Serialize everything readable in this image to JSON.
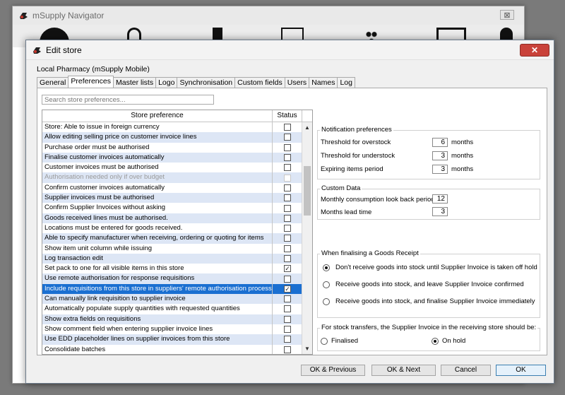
{
  "navigator": {
    "title": "mSupply Navigator",
    "close_label": "⊠"
  },
  "dialog": {
    "title": "Edit store",
    "close_label": "✕",
    "store_name": "Local Pharmacy (mSupply Mobile)",
    "tabs": [
      "General",
      "Preferences",
      "Master lists",
      "Logo",
      "Synchronisation",
      "Custom fields",
      "Users",
      "Names",
      "Log"
    ],
    "active_tab": "Preferences",
    "search_placeholder": "Search store preferences...",
    "table": {
      "col_preference": "Store preference",
      "col_status": "Status",
      "rows": [
        {
          "label": "Store: Able to issue in foreign currency",
          "checked": false
        },
        {
          "label": "Allow editing selling price on customer invoice lines",
          "checked": false
        },
        {
          "label": "Purchase order must be authorised",
          "checked": false
        },
        {
          "label": "Finalise customer invoices automatically",
          "checked": false
        },
        {
          "label": "Customer invoices must be authorised",
          "checked": false
        },
        {
          "label": "Authorisation needed only if over budget",
          "checked": false,
          "disabled": true
        },
        {
          "label": "Confirm customer invoices automatically",
          "checked": false
        },
        {
          "label": "Supplier invoices must be authorised",
          "checked": false
        },
        {
          "label": "Confirm Supplier Invoices without asking",
          "checked": false
        },
        {
          "label": "Goods received lines must be authorised.",
          "checked": false
        },
        {
          "label": "Locations must be entered for goods received.",
          "checked": false
        },
        {
          "label": "Able to specify manufacturer when receiving, ordering or quoting for items",
          "checked": false
        },
        {
          "label": "Show item unit column while issuing",
          "checked": false
        },
        {
          "label": "Log transaction edit",
          "checked": false
        },
        {
          "label": "Set pack to one for all visible items in this store",
          "checked": true
        },
        {
          "label": "Use remote authorisation for response requisitions",
          "checked": false
        },
        {
          "label": "Include requisitions from this store in suppliers' remote authorisation processes",
          "checked": true,
          "selected": true
        },
        {
          "label": "Can manually link requisition to supplier invoice",
          "checked": false
        },
        {
          "label": "Automatically populate supply quantities with requested quantities",
          "checked": false
        },
        {
          "label": "Show extra fields on requisitions",
          "checked": false
        },
        {
          "label": "Show comment field when entering supplier invoice lines",
          "checked": false
        },
        {
          "label": "Use EDD placeholder lines on supplier invoices from this store",
          "checked": false
        },
        {
          "label": "Consolidate batches",
          "checked": false
        }
      ]
    },
    "notification": {
      "legend": "Notification preferences",
      "overstock_label": "Threshold for overstock",
      "overstock_value": "6",
      "understock_label": "Threshold for understock",
      "understock_value": "3",
      "expiring_label": "Expiring items period",
      "expiring_value": "3",
      "unit": "months"
    },
    "custom_data": {
      "legend": "Custom Data",
      "lookback_label": "Monthly consumption look back period",
      "lookback_value": "12",
      "lead_time_label": "Months lead time",
      "lead_time_value": "3"
    },
    "goods_receipt": {
      "legend": "When finalising a Goods Receipt",
      "options": [
        "Don't receive goods into stock until Supplier Invoice is taken off hold",
        "Receive goods into stock, and leave Supplier Invoice confirmed",
        "Receive goods into stock, and finalise Supplier Invoice immediately"
      ],
      "selected_index": 0
    },
    "stock_transfers": {
      "legend": "For stock transfers, the Supplier Invoice in the receiving store should be:",
      "finalised_label": "Finalised",
      "on_hold_label": "On hold",
      "selected": "On hold"
    },
    "buttons": {
      "ok_previous": "OK & Previous",
      "ok_next": "OK & Next",
      "cancel": "Cancel",
      "ok": "OK"
    }
  }
}
